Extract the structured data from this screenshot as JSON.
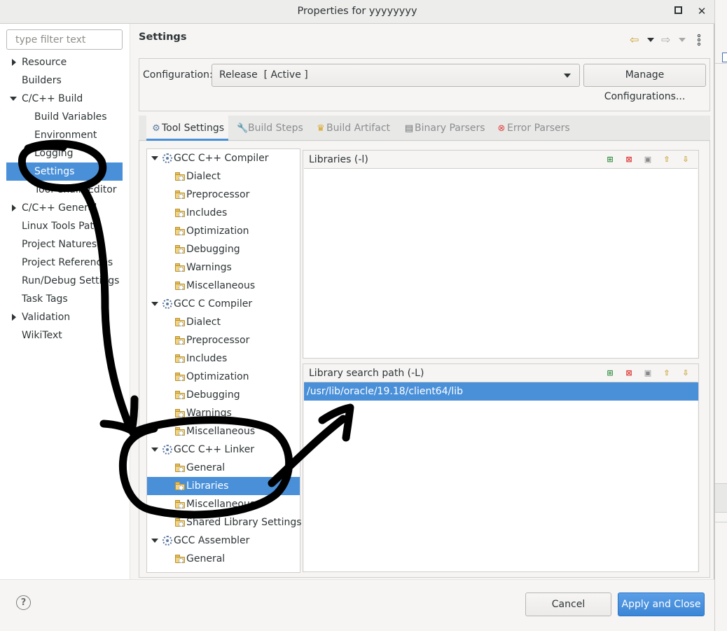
{
  "window": {
    "title": "Properties for yyyyyyyy",
    "maximize_icon": "maximize-icon",
    "close_glyph": "✕"
  },
  "filter": {
    "placeholder": "type filter text",
    "value": ""
  },
  "nav": {
    "items": [
      {
        "label": "Resource",
        "expander": "collapsed"
      },
      {
        "label": "Builders"
      },
      {
        "label": "C/C++ Build",
        "expander": "expanded"
      },
      {
        "label": "Build Variables"
      },
      {
        "label": "Environment"
      },
      {
        "label": "Logging"
      },
      {
        "label": "Settings",
        "selected": true
      },
      {
        "label": "Tool Chain Editor"
      },
      {
        "label": "C/C++ General",
        "expander": "collapsed"
      },
      {
        "label": "Linux Tools Path"
      },
      {
        "label": "Project Natures"
      },
      {
        "label": "Project References"
      },
      {
        "label": "Run/Debug Settings"
      },
      {
        "label": "Task Tags"
      },
      {
        "label": "Validation",
        "expander": "collapsed"
      },
      {
        "label": "WikiText"
      }
    ]
  },
  "page": {
    "title": "Settings",
    "nav_icons": [
      "back-arrow-icon",
      "back-menu-icon",
      "forward-arrow-icon",
      "forward-menu-icon",
      "view-menu-icon"
    ]
  },
  "configuration": {
    "label": "Configuration:",
    "value": "Release  [ Active ]",
    "manage_label": "Manage Configurations..."
  },
  "tabs": [
    {
      "label": "Tool Settings",
      "icon": "tool-settings-icon",
      "active": true
    },
    {
      "label": "Build Steps",
      "icon": "build-steps-icon"
    },
    {
      "label": "Build Artifact",
      "icon": "build-artifact-icon"
    },
    {
      "label": "Binary Parsers",
      "icon": "binary-parsers-icon"
    },
    {
      "label": "Error Parsers",
      "icon": "error-parsers-icon"
    }
  ],
  "tool_tree": [
    {
      "label": "GCC C++ Compiler",
      "kind": "tool"
    },
    {
      "label": "Dialect",
      "kind": "option"
    },
    {
      "label": "Preprocessor",
      "kind": "option"
    },
    {
      "label": "Includes",
      "kind": "option"
    },
    {
      "label": "Optimization",
      "kind": "option"
    },
    {
      "label": "Debugging",
      "kind": "option"
    },
    {
      "label": "Warnings",
      "kind": "option"
    },
    {
      "label": "Miscellaneous",
      "kind": "option"
    },
    {
      "label": "GCC C Compiler",
      "kind": "tool"
    },
    {
      "label": "Dialect",
      "kind": "option"
    },
    {
      "label": "Preprocessor",
      "kind": "option"
    },
    {
      "label": "Includes",
      "kind": "option"
    },
    {
      "label": "Optimization",
      "kind": "option"
    },
    {
      "label": "Debugging",
      "kind": "option"
    },
    {
      "label": "Warnings",
      "kind": "option"
    },
    {
      "label": "Miscellaneous",
      "kind": "option"
    },
    {
      "label": "GCC C++ Linker",
      "kind": "tool"
    },
    {
      "label": "General",
      "kind": "option"
    },
    {
      "label": "Libraries",
      "kind": "option",
      "selected": true
    },
    {
      "label": "Miscellaneous",
      "kind": "option"
    },
    {
      "label": "Shared Library Settings",
      "kind": "option"
    },
    {
      "label": "GCC Assembler",
      "kind": "tool"
    },
    {
      "label": "General",
      "kind": "option"
    }
  ],
  "libraries": {
    "header": "Libraries (-l)",
    "items": [],
    "toolbar": [
      "add-icon",
      "delete-icon",
      "edit-icon",
      "move-up-icon",
      "move-down-icon"
    ]
  },
  "library_paths": {
    "header": "Library search path (-L)",
    "items": [
      "/usr/lib/oracle/19.18/client64/lib"
    ],
    "selected_index": 0,
    "toolbar": [
      "add-icon",
      "delete-icon",
      "edit-icon",
      "move-up-icon",
      "move-down-icon"
    ]
  },
  "footer": {
    "help_icon": "help-icon",
    "help_glyph": "?",
    "cancel_label": "Cancel",
    "apply_label": "Apply and Close"
  },
  "colors": {
    "selection": "#4a90d9",
    "annotation": "#000000"
  }
}
